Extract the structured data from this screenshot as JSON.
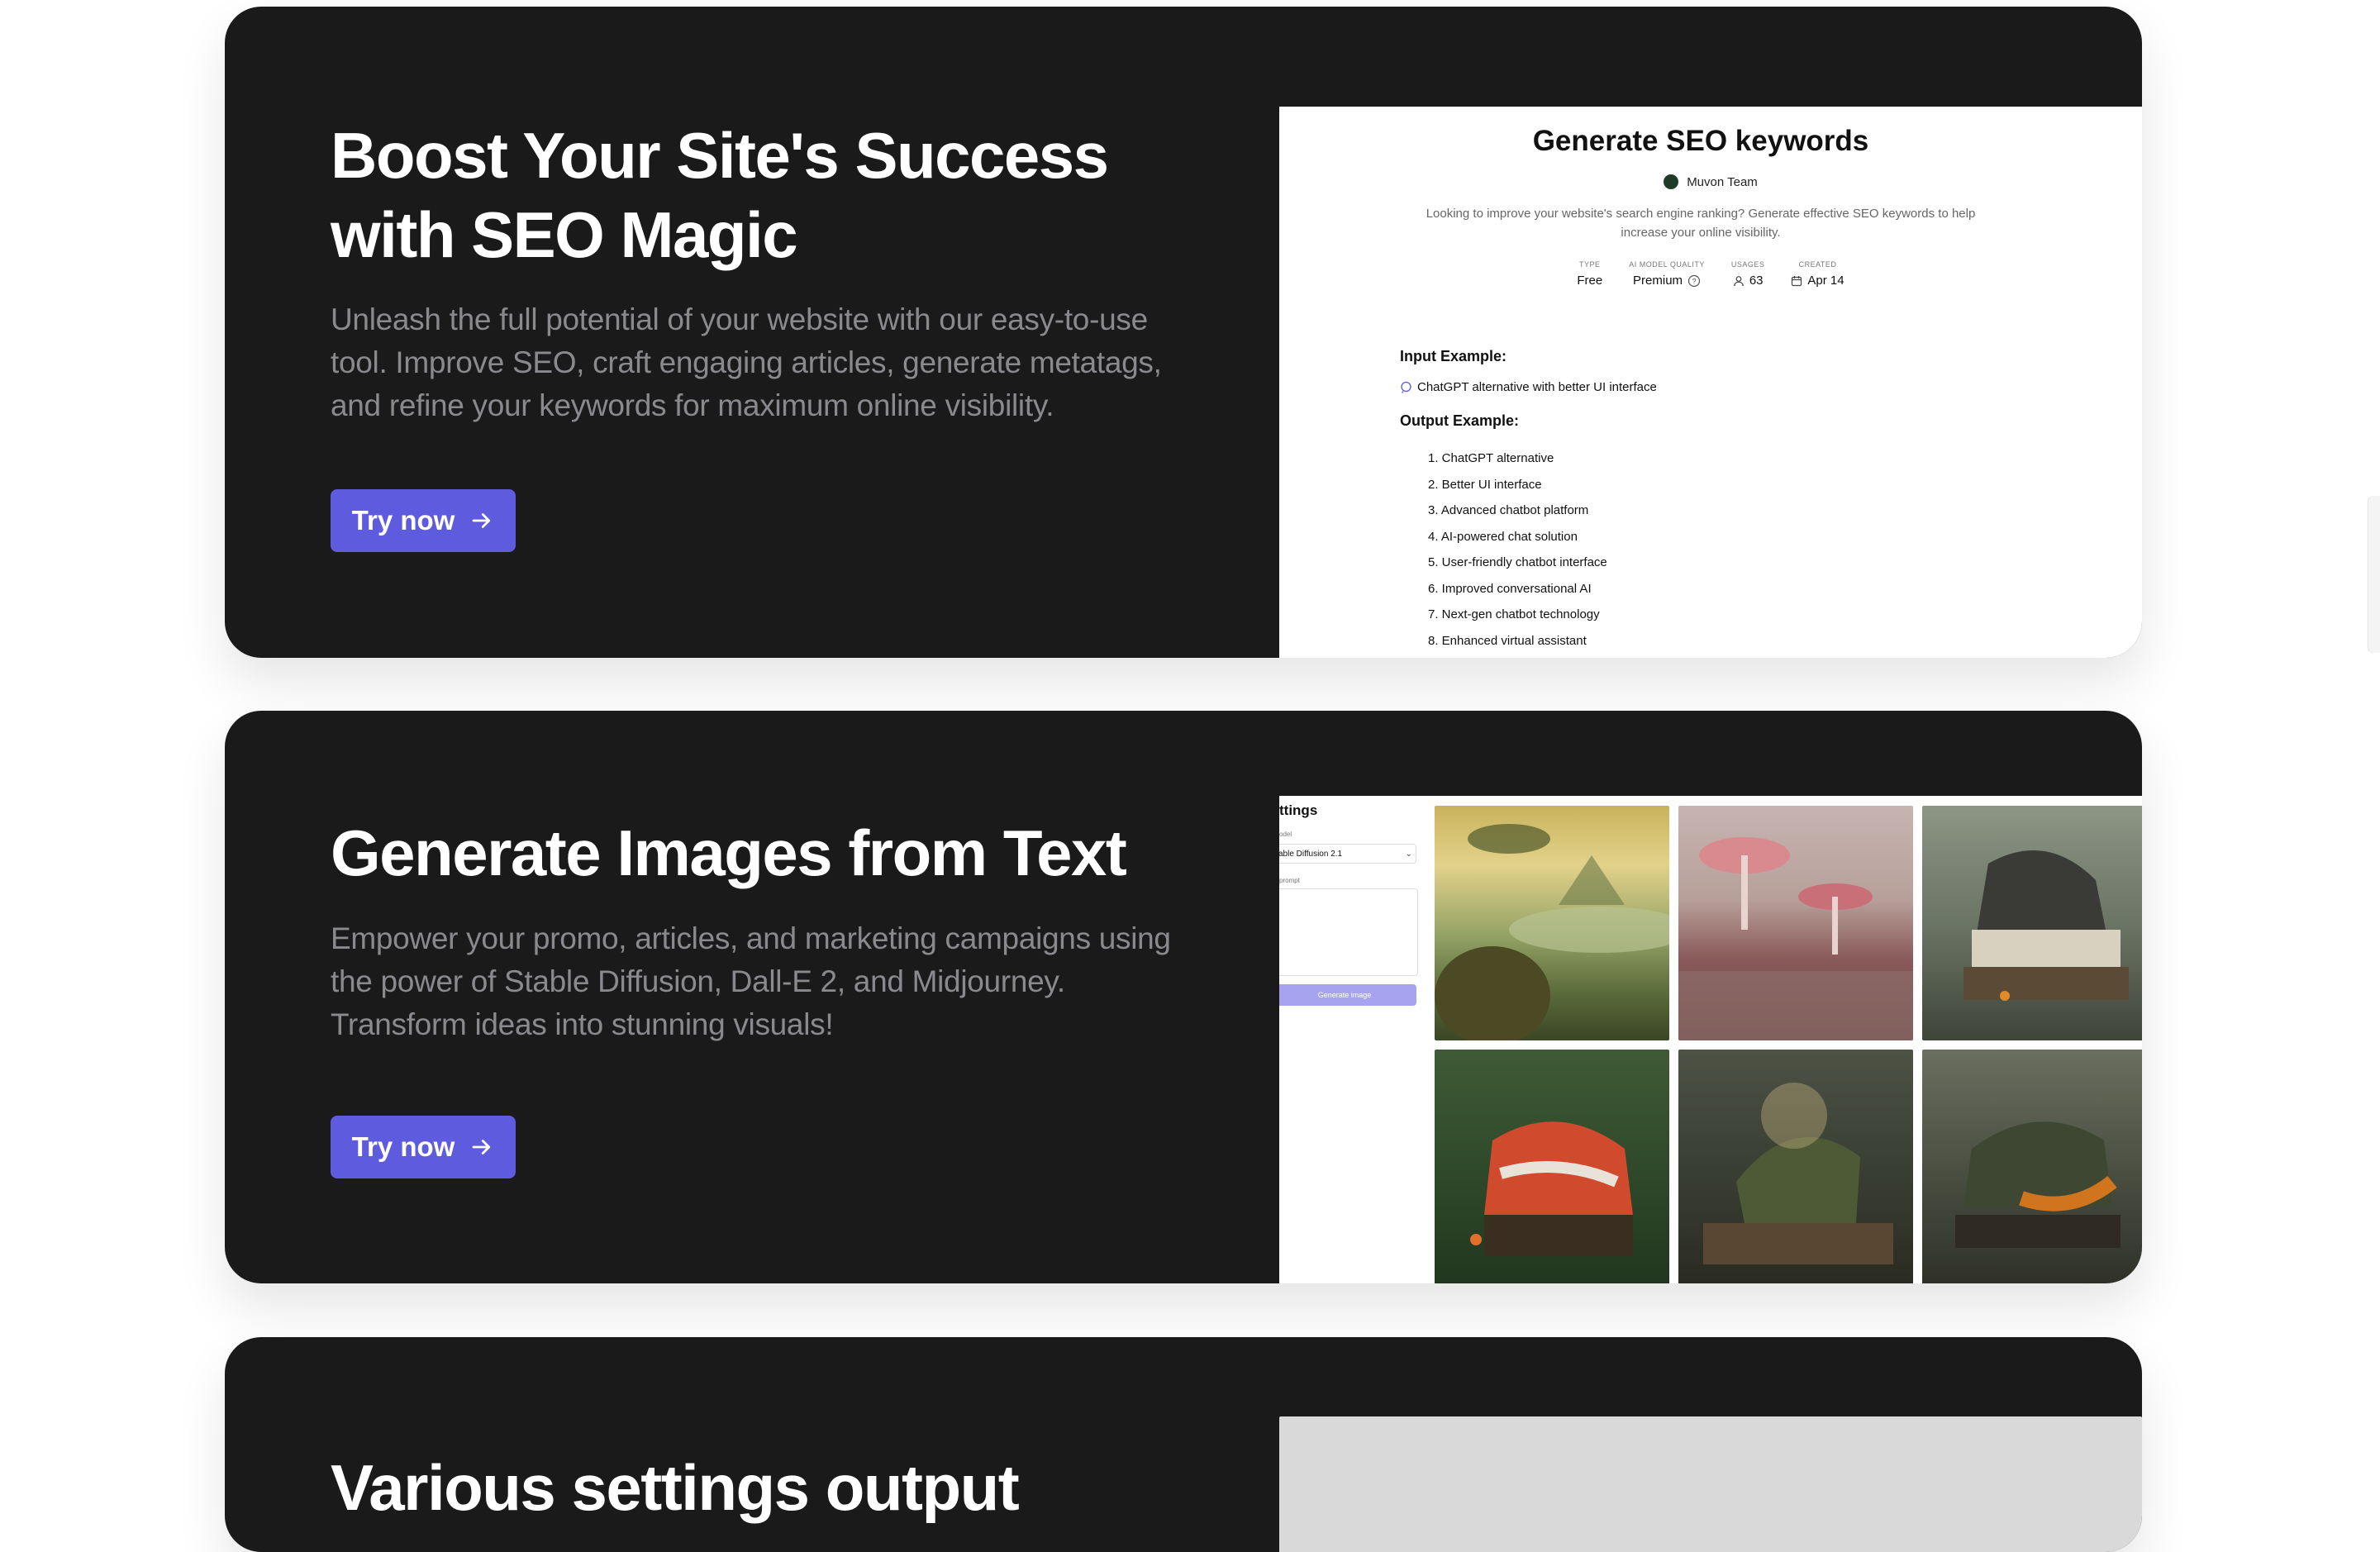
{
  "cards": [
    {
      "title_line1": "Boost Your Site's Success",
      "title_line2": "with SEO Magic",
      "description": "Unleash the full potential of your website with our easy-to-use tool. Improve SEO, craft engaging articles, generate metatags, and refine your keywords for maximum online visibility.",
      "button_label": "Try now"
    },
    {
      "title": "Generate Images from Text",
      "description": "Empower your promo, articles, and marketing campaigns using the power of Stable Diffusion, Dall-E 2, and Midjourney. Transform ideas into stunning visuals!",
      "button_label": "Try now"
    },
    {
      "title": "Various settings output"
    }
  ],
  "seo_preview": {
    "title": "Generate SEO keywords",
    "author": "Muvon Team",
    "description": "Looking to improve your website's search engine ranking? Generate effective SEO keywords to help increase your online visibility.",
    "meta": [
      {
        "key": "TYPE",
        "value": "Free"
      },
      {
        "key": "AI MODEL QUALITY",
        "value": "Premium"
      },
      {
        "key": "USAGES",
        "value": "63"
      },
      {
        "key": "CREATED",
        "value": "Apr 14"
      }
    ],
    "input_heading": "Input Example:",
    "input_text": "ChatGPT alternative with better UI interface",
    "output_heading": "Output Example:",
    "output_items": [
      "1. ChatGPT alternative",
      "2. Better UI interface",
      "3. Advanced chatbot platform",
      "4. AI-powered chat solution",
      "5. User-friendly chatbot interface",
      "6. Improved conversational AI",
      "7. Next-gen chatbot technology",
      "8. Enhanced virtual assistant"
    ]
  },
  "image_preview": {
    "settings_title": "ttings",
    "model_label": "odel",
    "model_value": "able Diffusion 2.1",
    "prompt_label": "prompt",
    "generate_button": "Generate image",
    "images": [
      "floating-island-landscape",
      "pink-mushroom-forest",
      "giant-sneaker-construction",
      "red-sneaker-ruin-forest",
      "mossy-shoe-hut",
      "forest-shoe-house"
    ]
  },
  "colors": {
    "card_bg": "#1b1a1b",
    "accent": "#5f5bdf",
    "muted_text": "#8a8a8e"
  }
}
